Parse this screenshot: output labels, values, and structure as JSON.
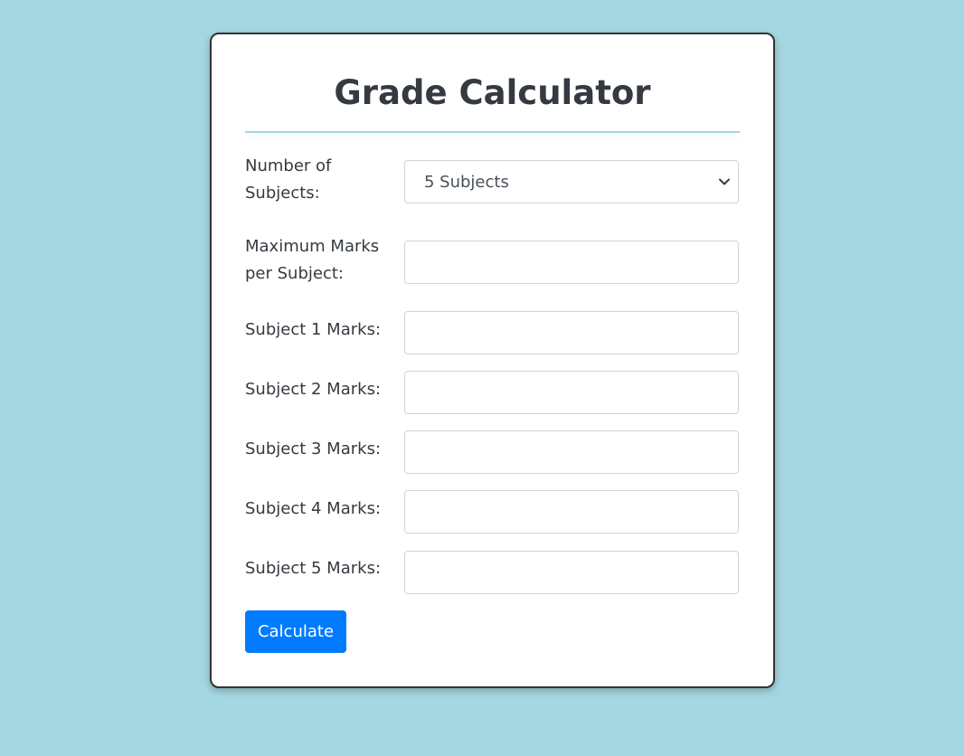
{
  "form": {
    "title": "Grade Calculator",
    "num_subjects_label": "Number of Subjects:",
    "num_subjects_value": "5 Subjects",
    "max_marks_label": "Maximum Marks per Subject:",
    "max_marks_value": "",
    "subjects": [
      {
        "label": "Subject 1 Marks:",
        "value": ""
      },
      {
        "label": "Subject 2 Marks:",
        "value": ""
      },
      {
        "label": "Subject 3 Marks:",
        "value": ""
      },
      {
        "label": "Subject 4 Marks:",
        "value": ""
      },
      {
        "label": "Subject 5 Marks:",
        "value": ""
      }
    ],
    "calculate_label": "Calculate"
  },
  "colors": {
    "background": "#a4d7e1",
    "card": "#ffffff",
    "primary": "#007bff",
    "text": "#343a40"
  },
  "icons": {
    "select_arrow": "chevron-down-icon"
  }
}
